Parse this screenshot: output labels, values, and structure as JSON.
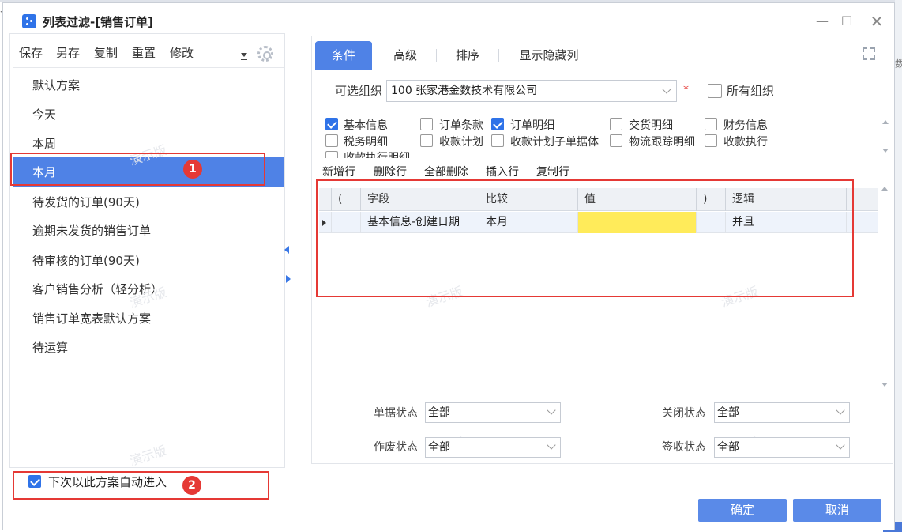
{
  "window": {
    "title": "列表过滤-[销售订单]"
  },
  "left_toolbar": {
    "save": "保存",
    "save_as": "另存",
    "copy": "复制",
    "reset": "重置",
    "modify": "修改"
  },
  "schemes": [
    "默认方案",
    "今天",
    "本周",
    "本月",
    "待发货的订单(90天)",
    "逾期未发货的销售订单",
    "待审核的订单(90天)",
    "客户销售分析（轻分析）",
    "销售订单宽表默认方案",
    "待运算"
  ],
  "selected_scheme": "本月",
  "auto_enter": {
    "label": "下次以此方案自动进入",
    "checked": true
  },
  "annotations": {
    "badge1": "1",
    "badge2": "2"
  },
  "tabs": [
    "条件",
    "高级",
    "排序",
    "显示隐藏列"
  ],
  "active_tab": "条件",
  "org": {
    "label": "可选组织",
    "value": "100 张家港金数技术有限公司",
    "required_mark": "*",
    "all_org_label": "所有组织",
    "all_org_checked": false
  },
  "options": [
    {
      "label": "基本信息",
      "checked": true
    },
    {
      "label": "订单条款",
      "checked": false
    },
    {
      "label": "订单明细",
      "checked": true
    },
    {
      "label": "交货明细",
      "checked": false
    },
    {
      "label": "财务信息",
      "checked": false
    },
    {
      "label": "税务明细",
      "checked": false
    },
    {
      "label": "收款计划",
      "checked": false
    },
    {
      "label": "收款计划子单据体",
      "checked": false
    },
    {
      "label": "物流跟踪明细",
      "checked": false
    },
    {
      "label": "收款执行",
      "checked": false
    },
    {
      "label": "收款执行明细",
      "checked": false
    }
  ],
  "grid_toolbar": {
    "add_row": "新增行",
    "delete_row": "删除行",
    "delete_all": "全部删除",
    "insert_row": "插入行",
    "copy_row": "复制行"
  },
  "grid": {
    "headers": {
      "lparen": "(",
      "field": "字段",
      "compare": "比较",
      "value": "值",
      "rparen": ")",
      "logic": "逻辑"
    },
    "rows": [
      {
        "lparen": "",
        "field": "基本信息-创建日期",
        "compare": "本月",
        "value": "",
        "rparen": "",
        "logic": "并且"
      }
    ]
  },
  "status": {
    "doc_status": {
      "label": "单据状态",
      "value": "全部"
    },
    "close_status": {
      "label": "关闭状态",
      "value": "全部"
    },
    "void_status": {
      "label": "作废状态",
      "value": "全部"
    },
    "sign_status": {
      "label": "签收状态",
      "value": "全部"
    }
  },
  "buttons": {
    "ok": "确定",
    "cancel": "取消"
  },
  "watermark": "演示版",
  "background_fragments": {
    "left": "合",
    "right": "数"
  },
  "colors": {
    "accent": "#4f82e6",
    "annotation": "#e53935",
    "highlight": "#ffeb5a"
  }
}
